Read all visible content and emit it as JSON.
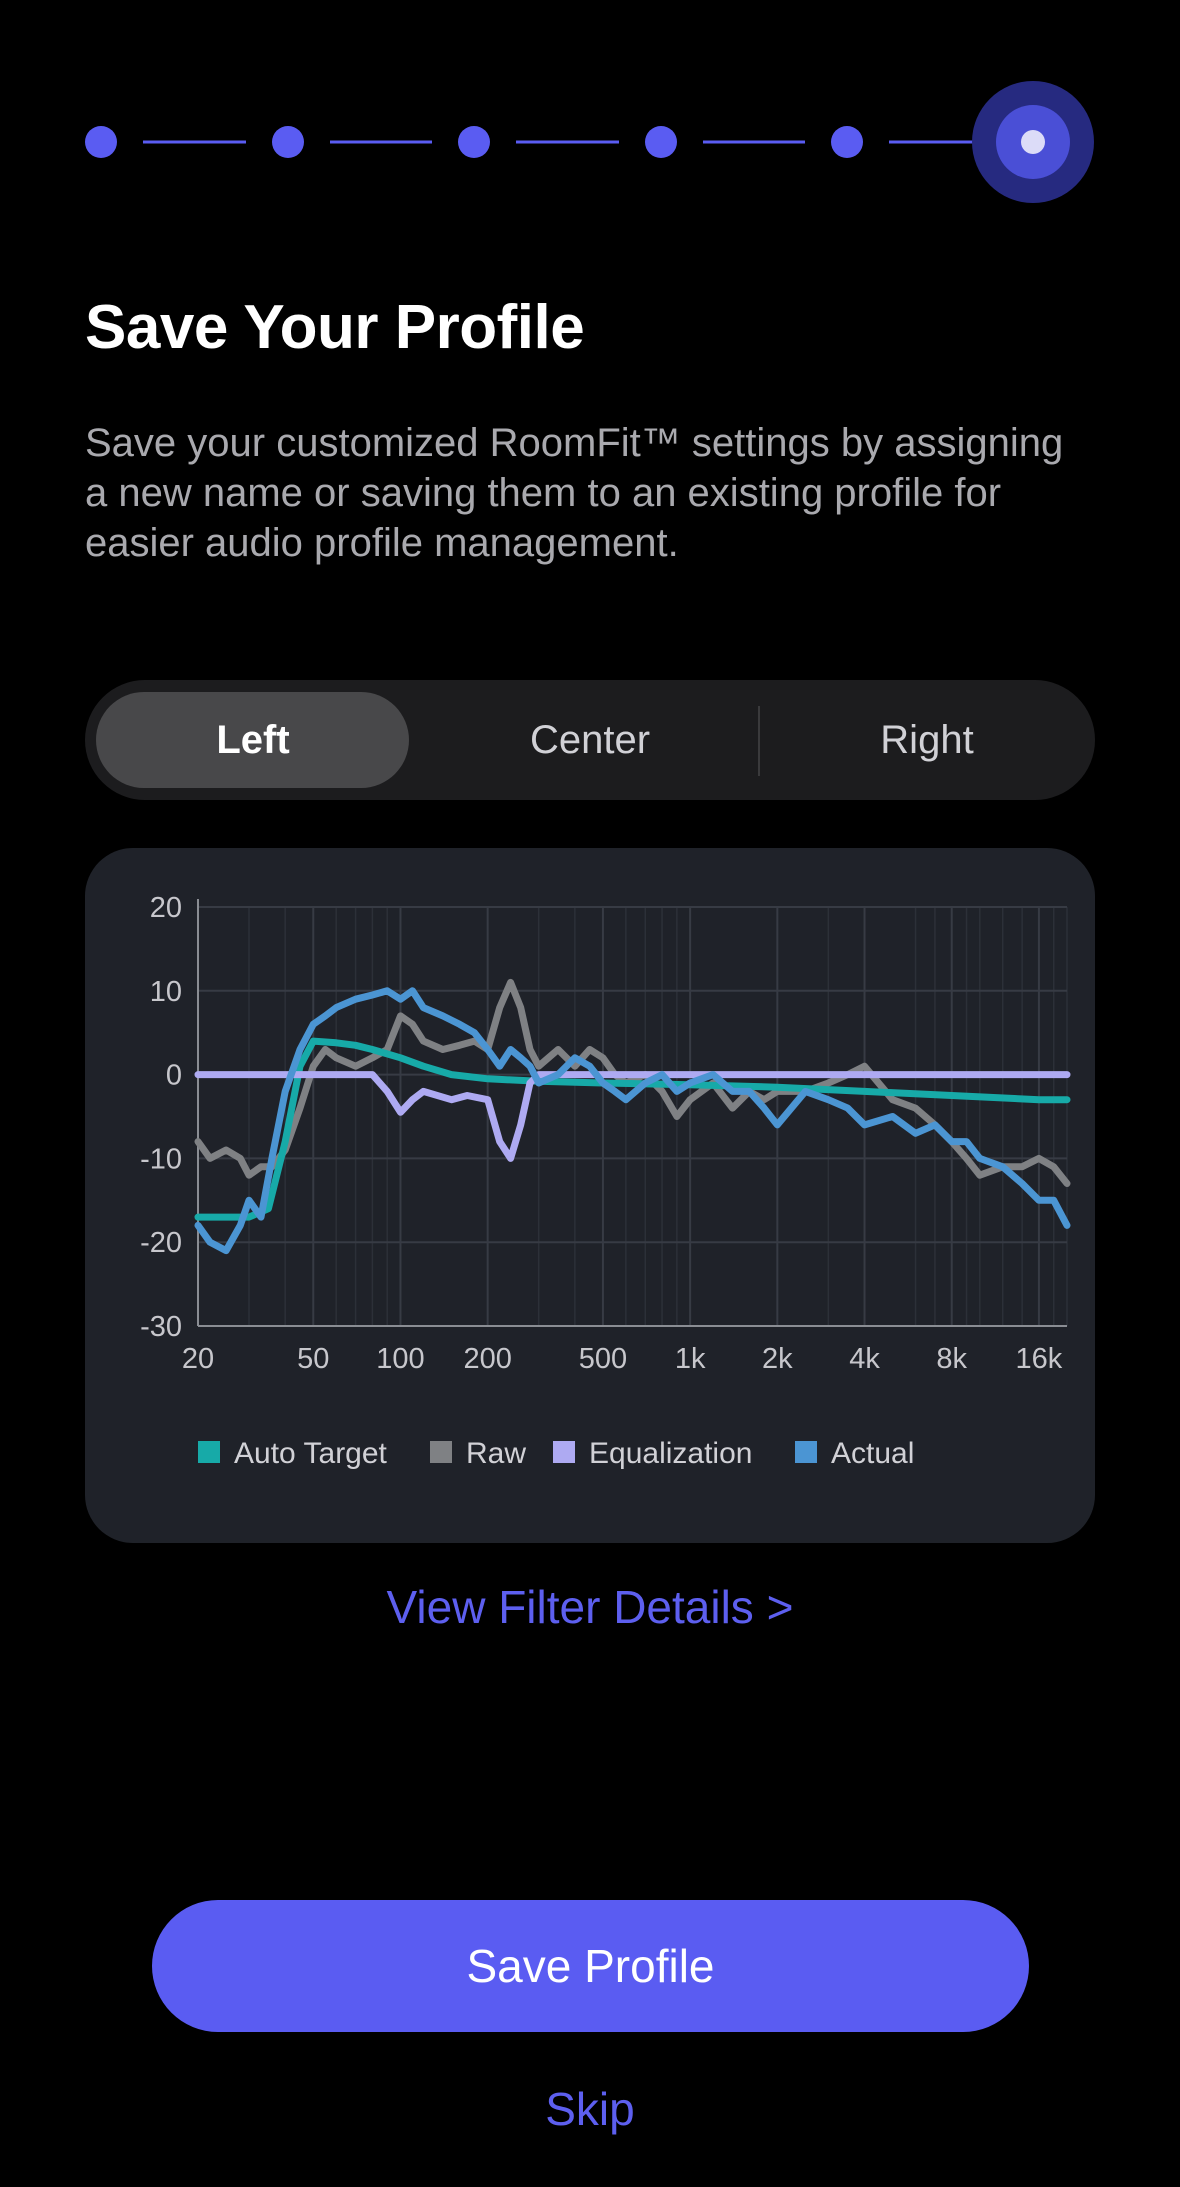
{
  "stepper": {
    "total_steps": 6,
    "current_step": 6
  },
  "page": {
    "title": "Save Your Profile",
    "description": "Save your customized RoomFit™ settings by assigning a new name or saving them to an existing profile for easier audio profile management."
  },
  "segments": {
    "items": [
      "Left",
      "Center",
      "Right"
    ],
    "selected": "Left"
  },
  "chart_data": {
    "type": "line",
    "x_scale": "log",
    "x_ticks": [
      {
        "value": 20,
        "label": "20"
      },
      {
        "value": 50,
        "label": "50"
      },
      {
        "value": 100,
        "label": "100"
      },
      {
        "value": 200,
        "label": "200"
      },
      {
        "value": 500,
        "label": "500"
      },
      {
        "value": 1000,
        "label": "1k"
      },
      {
        "value": 2000,
        "label": "2k"
      },
      {
        "value": 4000,
        "label": "4k"
      },
      {
        "value": 8000,
        "label": "8k"
      },
      {
        "value": 16000,
        "label": "16k"
      }
    ],
    "xlim": [
      20,
      20000
    ],
    "ylim": [
      -30,
      20
    ],
    "y_ticks": [
      20,
      10,
      0,
      -10,
      -20,
      -30
    ],
    "grid": true,
    "legend_position": "bottom",
    "series": [
      {
        "name": "Auto Target",
        "color": "#17aaa8",
        "x": [
          20,
          25,
          30,
          35,
          40,
          45,
          50,
          60,
          70,
          80,
          100,
          120,
          150,
          200,
          300,
          500,
          1000,
          2000,
          4000,
          8000,
          16000,
          20000
        ],
        "y": [
          -17,
          -17,
          -17,
          -16,
          -8,
          1,
          4,
          3.8,
          3.5,
          3,
          2,
          1,
          0,
          -0.5,
          -0.8,
          -1,
          -1.2,
          -1.5,
          -2,
          -2.5,
          -3,
          -3
        ]
      },
      {
        "name": "Raw",
        "color": "#7f8184",
        "x": [
          20,
          22,
          25,
          28,
          30,
          33,
          36,
          40,
          45,
          50,
          55,
          60,
          70,
          80,
          90,
          100,
          110,
          120,
          140,
          160,
          180,
          200,
          220,
          240,
          260,
          280,
          300,
          350,
          400,
          450,
          500,
          550,
          600,
          700,
          800,
          900,
          1000,
          1200,
          1400,
          1600,
          1800,
          2000,
          2500,
          3000,
          3500,
          4000,
          5000,
          6000,
          7000,
          8000,
          9000,
          10000,
          12000,
          14000,
          16000,
          18000,
          20000
        ],
        "y": [
          -8,
          -10,
          -9,
          -10,
          -12,
          -11,
          -11,
          -9,
          -4,
          1,
          3,
          2,
          1,
          2,
          3,
          7,
          6,
          4,
          3,
          3.5,
          4,
          3,
          8,
          11,
          8,
          3,
          1,
          3,
          1,
          3,
          2,
          0,
          -1,
          0,
          -2,
          -5,
          -3,
          -1,
          -4,
          -2,
          -3,
          -2,
          -2,
          -1,
          0,
          1,
          -3,
          -4,
          -6,
          -8,
          -10,
          -12,
          -11,
          -11,
          -10,
          -11,
          -13
        ]
      },
      {
        "name": "Equalization",
        "color": "#aeaaf2",
        "x": [
          20,
          40,
          60,
          80,
          90,
          100,
          110,
          120,
          150,
          170,
          200,
          220,
          240,
          260,
          280,
          300,
          400,
          500,
          20000
        ],
        "y": [
          0,
          0,
          0,
          0,
          -2,
          -4.5,
          -3,
          -2,
          -3,
          -2.5,
          -3,
          -8,
          -10,
          -6,
          -1,
          0,
          0,
          0,
          0
        ]
      },
      {
        "name": "Actual",
        "color": "#4b95d3",
        "x": [
          20,
          22,
          25,
          28,
          30,
          33,
          36,
          40,
          45,
          50,
          55,
          60,
          70,
          80,
          90,
          100,
          110,
          120,
          140,
          160,
          180,
          200,
          220,
          240,
          260,
          280,
          300,
          350,
          400,
          450,
          500,
          550,
          600,
          700,
          800,
          900,
          1000,
          1200,
          1400,
          1600,
          1800,
          2000,
          2500,
          3000,
          3500,
          4000,
          5000,
          6000,
          7000,
          8000,
          9000,
          10000,
          12000,
          14000,
          16000,
          18000,
          20000
        ],
        "y": [
          -18,
          -20,
          -21,
          -18,
          -15,
          -17,
          -10,
          -2,
          3,
          6,
          7,
          8,
          9,
          9.5,
          10,
          9,
          10,
          8,
          7,
          6,
          5,
          3,
          1,
          3,
          2,
          1,
          -1,
          0,
          2,
          1,
          -1,
          -2,
          -3,
          -1,
          0,
          -2,
          -1,
          0,
          -2,
          -2,
          -4,
          -6,
          -2,
          -3,
          -4,
          -6,
          -5,
          -7,
          -6,
          -8,
          -8,
          -10,
          -11,
          -13,
          -15,
          -15,
          -18
        ]
      }
    ]
  },
  "links": {
    "view_filter_details": "View Filter Details >"
  },
  "actions": {
    "save": "Save Profile",
    "skip": "Skip"
  }
}
